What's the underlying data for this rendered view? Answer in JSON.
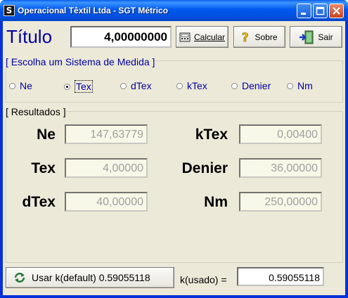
{
  "window": {
    "title": "Operacional Têxtil Ltda - SGT Métrico",
    "icon": "app-icon",
    "icon_glyph": "S"
  },
  "header": {
    "titulo_label": "Título",
    "titulo_value": "4,00000000"
  },
  "toolbar": {
    "calcular_label": "Calcular",
    "sobre_label": "Sobre",
    "sair_label": "Sair"
  },
  "sistema": {
    "group_title": "[ Escolha um Sistema de Medida ]",
    "options": [
      {
        "label": "Ne",
        "selected": false
      },
      {
        "label": "Tex",
        "selected": true
      },
      {
        "label": "dTex",
        "selected": false
      },
      {
        "label": "kTex",
        "selected": false
      },
      {
        "label": "Denier",
        "selected": false
      },
      {
        "label": "Nm",
        "selected": false
      }
    ]
  },
  "resultados": {
    "group_title": "[ Resultados ]",
    "fields": [
      {
        "label": "Ne",
        "value": "147,63779"
      },
      {
        "label": "kTex",
        "value": "0,00400"
      },
      {
        "label": "Tex",
        "value": "4,00000"
      },
      {
        "label": "Denier",
        "value": "36,00000"
      },
      {
        "label": "dTex",
        "value": "40,00000"
      },
      {
        "label": "Nm",
        "value": "250,00000"
      }
    ]
  },
  "footer": {
    "usar_k_label": "Usar k(default) 0.59055118",
    "k_usado_label": "k(usado) =",
    "k_usado_value": "0.59055118"
  },
  "colors": {
    "titlebar": "#0058ee",
    "label_blue": "#0000a0",
    "window_bg": "#ece9d8",
    "result_bg": "#f8f8e8"
  }
}
